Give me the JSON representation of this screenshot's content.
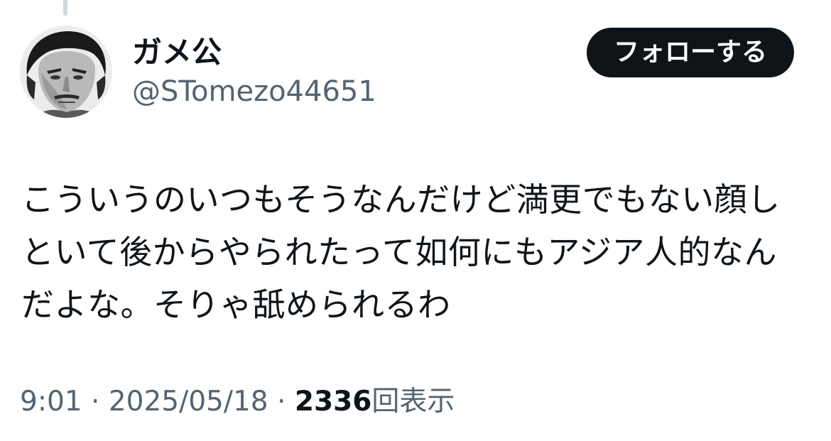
{
  "user": {
    "display_name": "ガメ公",
    "handle": "@STomezo44651",
    "avatar_icon": "portrait-avatar"
  },
  "follow_button": {
    "label": "フォローする",
    "background": "#0f1419",
    "text_color": "#ffffff"
  },
  "tweet": {
    "text": "こういうのいつもそうなんだけど満更でもない顔しといて後からやられたって如何にもアジア人的なんだよな。そりゃ舐められるわ"
  },
  "meta": {
    "time": "9:01",
    "separator": "·",
    "date": "2025/05/18",
    "views_count": "2336",
    "views_label": "回表示"
  },
  "colors": {
    "primary_text": "#0f1419",
    "secondary_text": "#536471",
    "thread_line": "#cfd9de"
  }
}
